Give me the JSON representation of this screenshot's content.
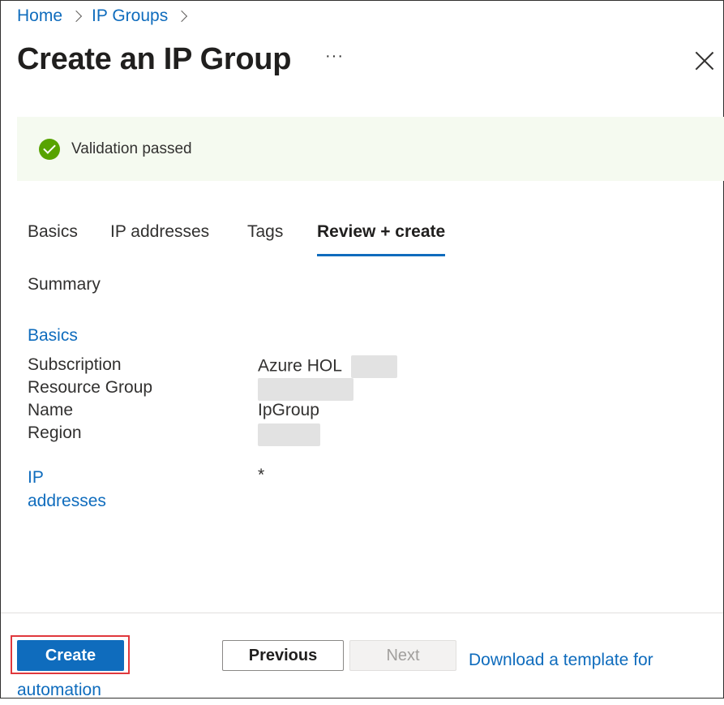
{
  "breadcrumb": {
    "home": "Home",
    "ip_groups": "IP Groups"
  },
  "header": {
    "title": "Create an IP Group",
    "more": "···"
  },
  "banner": {
    "text": "Validation passed",
    "color": "#57a300"
  },
  "tabs": [
    {
      "label": "Basics"
    },
    {
      "label": "IP addresses"
    },
    {
      "label": "Tags"
    },
    {
      "label": "Review + create",
      "active": true
    }
  ],
  "summary": {
    "heading": "Summary",
    "basics_heading": "Basics",
    "rows": [
      {
        "label": "Subscription",
        "value": "Azure HOL"
      },
      {
        "label": "Resource Group",
        "value": ""
      },
      {
        "label": "Name",
        "value": "IpGroup"
      },
      {
        "label": "Region",
        "value": ""
      }
    ],
    "ip_heading_1": "IP",
    "ip_heading_2": "addresses",
    "ip_value": "*"
  },
  "footer": {
    "create": "Create",
    "previous": "Previous",
    "next": "Next",
    "download": "Download a template for automation"
  },
  "colors": {
    "accent": "#0f6cbd",
    "highlight": "#e0383d",
    "banner_bg": "#f5faf0"
  }
}
